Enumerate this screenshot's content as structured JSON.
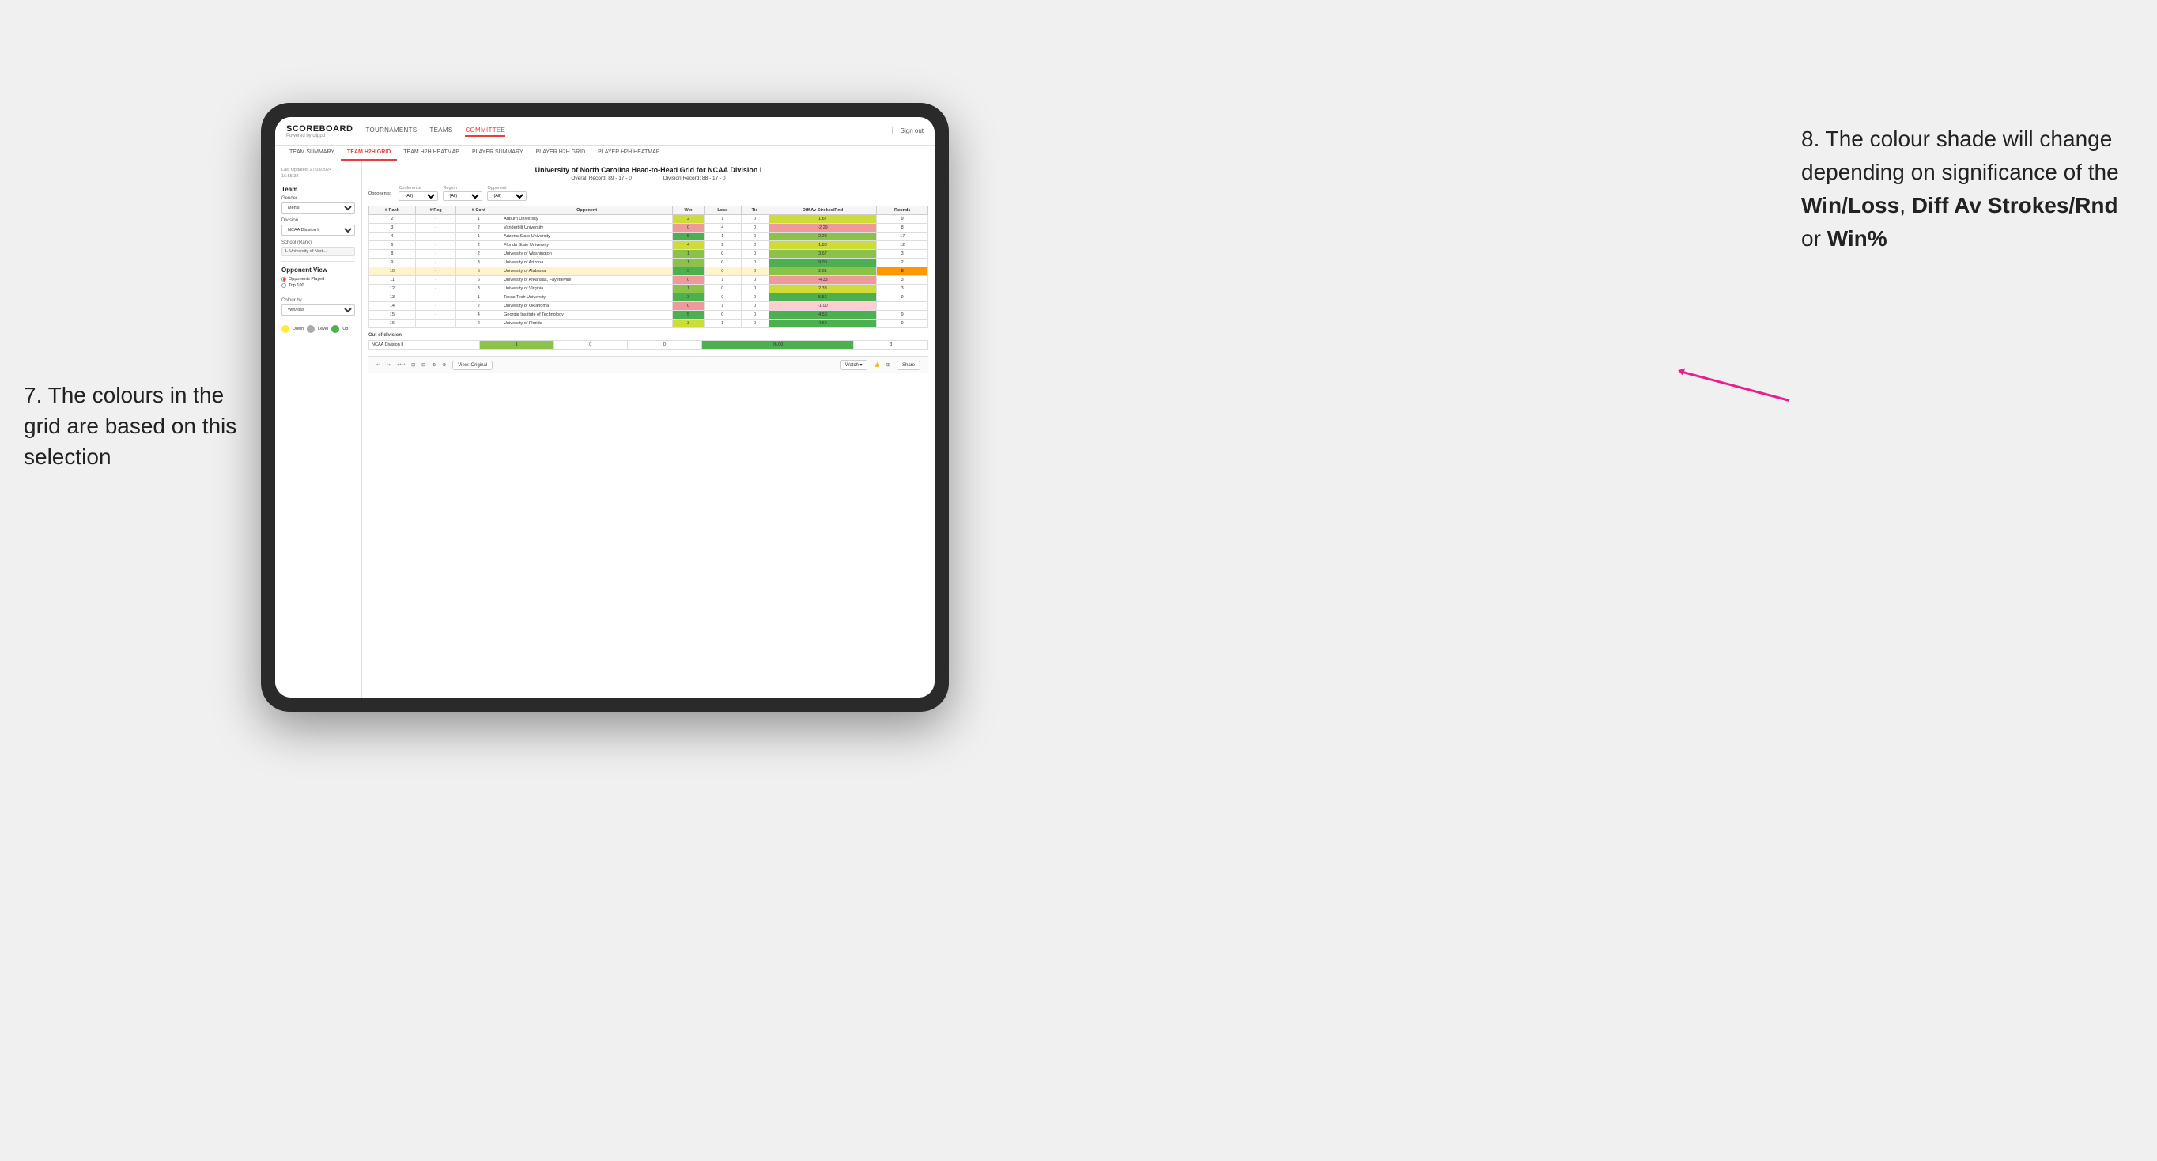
{
  "page": {
    "background": "#f0f0f0"
  },
  "annotation_left": {
    "text": "7. The colours in the grid are based on this selection"
  },
  "annotation_right": {
    "text_before": "8. The colour shade will change depending on significance of the ",
    "bold1": "Win/Loss",
    "text_mid1": ", ",
    "bold2": "Diff Av Strokes/Rnd",
    "text_mid2": " or ",
    "bold3": "Win%"
  },
  "nav": {
    "logo": "SCOREBOARD",
    "logo_sub": "Powered by clippd",
    "items": [
      {
        "label": "TOURNAMENTS",
        "active": false
      },
      {
        "label": "TEAMS",
        "active": false
      },
      {
        "label": "COMMITTEE",
        "active": true
      }
    ],
    "sign_out": "Sign out"
  },
  "sub_nav": {
    "items": [
      {
        "label": "TEAM SUMMARY",
        "active": false
      },
      {
        "label": "TEAM H2H GRID",
        "active": true
      },
      {
        "label": "TEAM H2H HEATMAP",
        "active": false
      },
      {
        "label": "PLAYER SUMMARY",
        "active": false
      },
      {
        "label": "PLAYER H2H GRID",
        "active": false
      },
      {
        "label": "PLAYER H2H HEATMAP",
        "active": false
      }
    ]
  },
  "sidebar": {
    "updated_label": "Last Updated: 27/03/2024",
    "updated_time": "16:55:38",
    "team_label": "Team",
    "gender_label": "Gender",
    "gender_value": "Men's",
    "division_label": "Division",
    "division_value": "NCAA Division I",
    "school_label": "School (Rank)",
    "school_value": "1. University of Nort...",
    "opponent_view_label": "Opponent View",
    "radio1": "Opponents Played",
    "radio2": "Top 100",
    "colour_by_label": "Colour by",
    "colour_by_value": "Win/loss",
    "legend": {
      "down_label": "Down",
      "level_label": "Level",
      "up_label": "Up"
    }
  },
  "grid": {
    "title": "University of North Carolina Head-to-Head Grid for NCAA Division I",
    "overall_record": "Overall Record: 89 - 17 - 0",
    "division_record": "Division Record: 88 - 17 - 0",
    "filters": {
      "opponents_label": "Opponents:",
      "conference_label": "Conference",
      "conference_value": "(All)",
      "region_label": "Region",
      "region_value": "(All)",
      "opponent_label": "Opponent",
      "opponent_value": "(All)"
    },
    "columns": [
      "# Rank",
      "# Reg",
      "# Conf",
      "Opponent",
      "Win",
      "Loss",
      "Tie",
      "Diff Av Strokes/Rnd",
      "Rounds"
    ],
    "rows": [
      {
        "rank": "2",
        "reg": "-",
        "conf": "1",
        "opponent": "Auburn University",
        "win": "2",
        "loss": "1",
        "tie": "0",
        "diff": "1.67",
        "rounds": "9",
        "win_color": "green_light",
        "diff_color": "green_light"
      },
      {
        "rank": "3",
        "reg": "-",
        "conf": "2",
        "opponent": "Vanderbilt University",
        "win": "0",
        "loss": "4",
        "tie": "0",
        "diff": "-2.29",
        "rounds": "8",
        "win_color": "red",
        "diff_color": "red"
      },
      {
        "rank": "4",
        "reg": "-",
        "conf": "1",
        "opponent": "Arizona State University",
        "win": "5",
        "loss": "1",
        "tie": "0",
        "diff": "2.28",
        "rounds": "",
        "rounds_val": "17",
        "win_color": "green_dark",
        "diff_color": "green_mid"
      },
      {
        "rank": "6",
        "reg": "-",
        "conf": "2",
        "opponent": "Florida State University",
        "win": "4",
        "loss": "2",
        "tie": "0",
        "diff": "1.83",
        "rounds": "12",
        "win_color": "green_light",
        "diff_color": "green_light"
      },
      {
        "rank": "8",
        "reg": "-",
        "conf": "2",
        "opponent": "University of Washington",
        "win": "1",
        "loss": "0",
        "tie": "0",
        "diff": "3.67",
        "rounds": "3",
        "win_color": "green_mid",
        "diff_color": "green_mid"
      },
      {
        "rank": "9",
        "reg": "-",
        "conf": "3",
        "opponent": "University of Arizona",
        "win": "1",
        "loss": "0",
        "tie": "0",
        "diff": "9.00",
        "rounds": "2",
        "win_color": "green_mid",
        "diff_color": "green_dark"
      },
      {
        "rank": "10",
        "reg": "-",
        "conf": "5",
        "opponent": "University of Alabama",
        "win": "3",
        "loss": "0",
        "tie": "0",
        "diff": "2.61",
        "rounds": "8",
        "win_color": "green_dark",
        "diff_color": "green_mid",
        "highlighted": true
      },
      {
        "rank": "11",
        "reg": "-",
        "conf": "6",
        "opponent": "University of Arkansas, Fayetteville",
        "win": "0",
        "loss": "1",
        "tie": "0",
        "diff": "-4.33",
        "rounds": "3",
        "win_color": "red",
        "diff_color": "red"
      },
      {
        "rank": "12",
        "reg": "-",
        "conf": "3",
        "opponent": "University of Virginia",
        "win": "1",
        "loss": "0",
        "tie": "0",
        "diff": "2.33",
        "rounds": "3",
        "win_color": "green_mid",
        "diff_color": "green_light"
      },
      {
        "rank": "13",
        "reg": "-",
        "conf": "1",
        "opponent": "Texas Tech University",
        "win": "3",
        "loss": "0",
        "tie": "0",
        "diff": "5.56",
        "rounds": "9",
        "win_color": "green_dark",
        "diff_color": "green_dark"
      },
      {
        "rank": "14",
        "reg": "-",
        "conf": "2",
        "opponent": "University of Oklahoma",
        "win": "0",
        "loss": "1",
        "tie": "0",
        "diff": "-1.00",
        "rounds": "",
        "win_color": "red",
        "diff_color": "red_light"
      },
      {
        "rank": "15",
        "reg": "-",
        "conf": "4",
        "opponent": "Georgia Institute of Technology",
        "win": "5",
        "loss": "0",
        "tie": "0",
        "diff": "4.50",
        "rounds": "9",
        "win_color": "green_dark",
        "diff_color": "green_dark"
      },
      {
        "rank": "16",
        "reg": "-",
        "conf": "2",
        "opponent": "University of Florida",
        "win": "3",
        "loss": "1",
        "tie": "0",
        "diff": "4.62",
        "rounds": "9",
        "win_color": "green_light",
        "diff_color": "green_dark"
      }
    ],
    "out_of_division_label": "Out of division",
    "out_of_division_row": {
      "division": "NCAA Division II",
      "win": "1",
      "loss": "0",
      "tie": "0",
      "diff": "26.00",
      "rounds": "3",
      "win_color": "green_mid",
      "diff_color": "green_dark"
    }
  },
  "toolbar": {
    "view_label": "View: Original",
    "watch_label": "Watch ▾",
    "share_label": "Share"
  }
}
